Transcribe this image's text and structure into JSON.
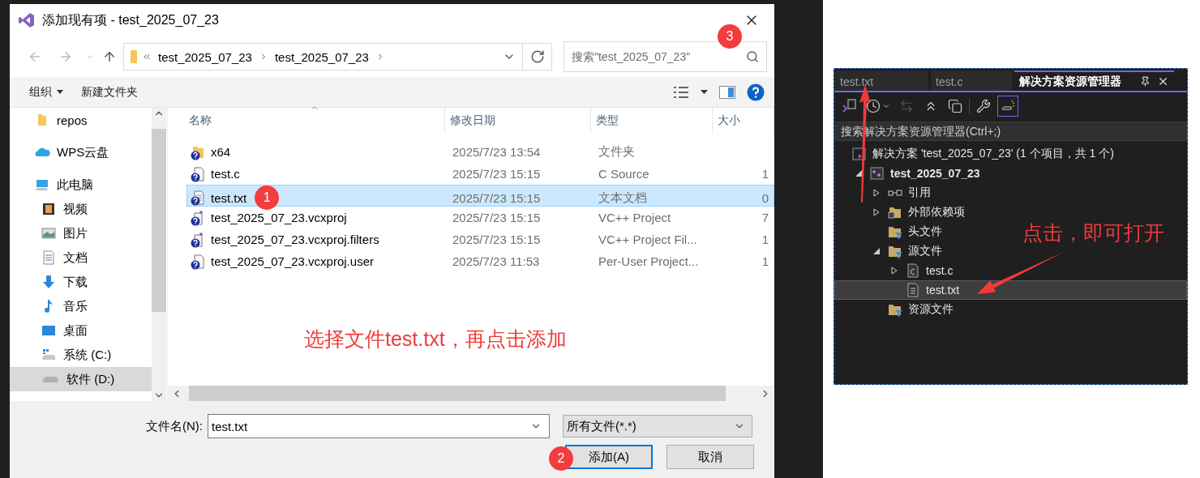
{
  "dialog": {
    "title": "添加现有项 - test_2025_07_23",
    "address": {
      "crumbs": [
        "test_2025_07_23",
        "test_2025_07_23"
      ]
    },
    "search": {
      "placeholder": "搜索\"test_2025_07_23\"",
      "badge": "3"
    },
    "toolbar": {
      "organize": "组织",
      "new_folder": "新建文件夹"
    },
    "sidebar": [
      {
        "label": "repos",
        "kind": "folder",
        "selected": false
      },
      {
        "label": "WPS云盘",
        "kind": "cloud",
        "selected": false
      },
      {
        "label": "此电脑",
        "kind": "pc",
        "selected": false,
        "children": [
          {
            "label": "视频",
            "kind": "video",
            "selected": false
          },
          {
            "label": "图片",
            "kind": "picture",
            "selected": false
          },
          {
            "label": "文档",
            "kind": "document",
            "selected": false
          },
          {
            "label": "下载",
            "kind": "download",
            "selected": false
          },
          {
            "label": "音乐",
            "kind": "music",
            "selected": false
          },
          {
            "label": "桌面",
            "kind": "desktop",
            "selected": false
          },
          {
            "label": "系统 (C:)",
            "kind": "system-drive",
            "selected": false
          },
          {
            "label": "软件 (D:)",
            "kind": "drive",
            "selected": true
          }
        ]
      }
    ],
    "columns": [
      "名称",
      "修改日期",
      "类型",
      "大小"
    ],
    "files": [
      {
        "name": "x64",
        "kind": "folder",
        "date": "2025/7/23 13:54",
        "type": "文件夹",
        "selected": false
      },
      {
        "name": "test.c",
        "kind": "file",
        "date": "2025/7/23 15:15",
        "type": "C Source",
        "size": "1",
        "selected": false
      },
      {
        "name": "test.txt",
        "kind": "text",
        "date": "2025/7/23 15:15",
        "type": "文本文档",
        "size": "0",
        "selected": true,
        "badge": "1"
      },
      {
        "name": "test_2025_07_23.vcxproj",
        "kind": "project",
        "date": "2025/7/23 15:15",
        "type": "VC++ Project",
        "size": "7",
        "selected": false
      },
      {
        "name": "test_2025_07_23.vcxproj.filters",
        "kind": "project",
        "date": "2025/7/23 15:15",
        "type": "VC++ Project Fil...",
        "size": "1",
        "selected": false
      },
      {
        "name": "test_2025_07_23.vcxproj.user",
        "kind": "file",
        "date": "2025/7/23 11:53",
        "type": "Per-User Project...",
        "size": "1",
        "selected": false
      }
    ],
    "note": "选择文件test.txt，再点击添加",
    "filename": {
      "label": "文件名(N):",
      "value": "test.txt"
    },
    "filter": {
      "value": "所有文件(*.*)"
    },
    "buttons": [
      {
        "label": "添加(A)",
        "kind": "primary",
        "badge": "2"
      },
      {
        "label": "取消",
        "kind": "default"
      }
    ]
  },
  "explorer": {
    "tabs": [
      {
        "label": "test.txt",
        "selected": false
      },
      {
        "label": "test.c",
        "selected": false
      },
      {
        "label": "解决方案资源管理器",
        "selected": true
      }
    ],
    "tools": [
      {
        "kind": "switch-views",
        "on": false,
        "disabled": false
      },
      {
        "kind": "history",
        "on": false,
        "disabled": false
      },
      {
        "kind": "sync",
        "on": false,
        "disabled": true
      },
      {
        "kind": "collapse",
        "on": false,
        "disabled": false
      },
      {
        "kind": "copy",
        "on": false,
        "disabled": false
      },
      {
        "kind": "properties",
        "on": false,
        "disabled": false
      },
      {
        "kind": "preview",
        "on": true,
        "disabled": false
      }
    ],
    "search": {
      "placeholder": "搜索解决方案资源管理器(Ctrl+;)"
    },
    "tree": [
      {
        "label": "解决方案 'test_2025_07_23' (1 个项目，共 1 个)",
        "kind": "solution",
        "selected": false,
        "children": [
          {
            "label": "test_2025_07_23",
            "kind": "project",
            "bold": true,
            "expanded": true,
            "selected": false,
            "children": [
              {
                "label": "引用",
                "kind": "references",
                "expanded": false,
                "selected": false
              },
              {
                "label": "外部依赖项",
                "kind": "external",
                "expanded": false,
                "selected": false
              },
              {
                "label": "头文件",
                "kind": "filter",
                "selected": false
              },
              {
                "label": "源文件",
                "kind": "filter",
                "expanded": true,
                "selected": false,
                "children": [
                  {
                    "label": "test.c",
                    "kind": "c-file",
                    "expanded": false,
                    "selected": false
                  },
                  {
                    "label": "test.txt",
                    "kind": "text-file",
                    "selected": true
                  }
                ]
              },
              {
                "label": "资源文件",
                "kind": "filter",
                "selected": false
              }
            ]
          }
        ]
      }
    ],
    "note": "点击，即可打开"
  }
}
